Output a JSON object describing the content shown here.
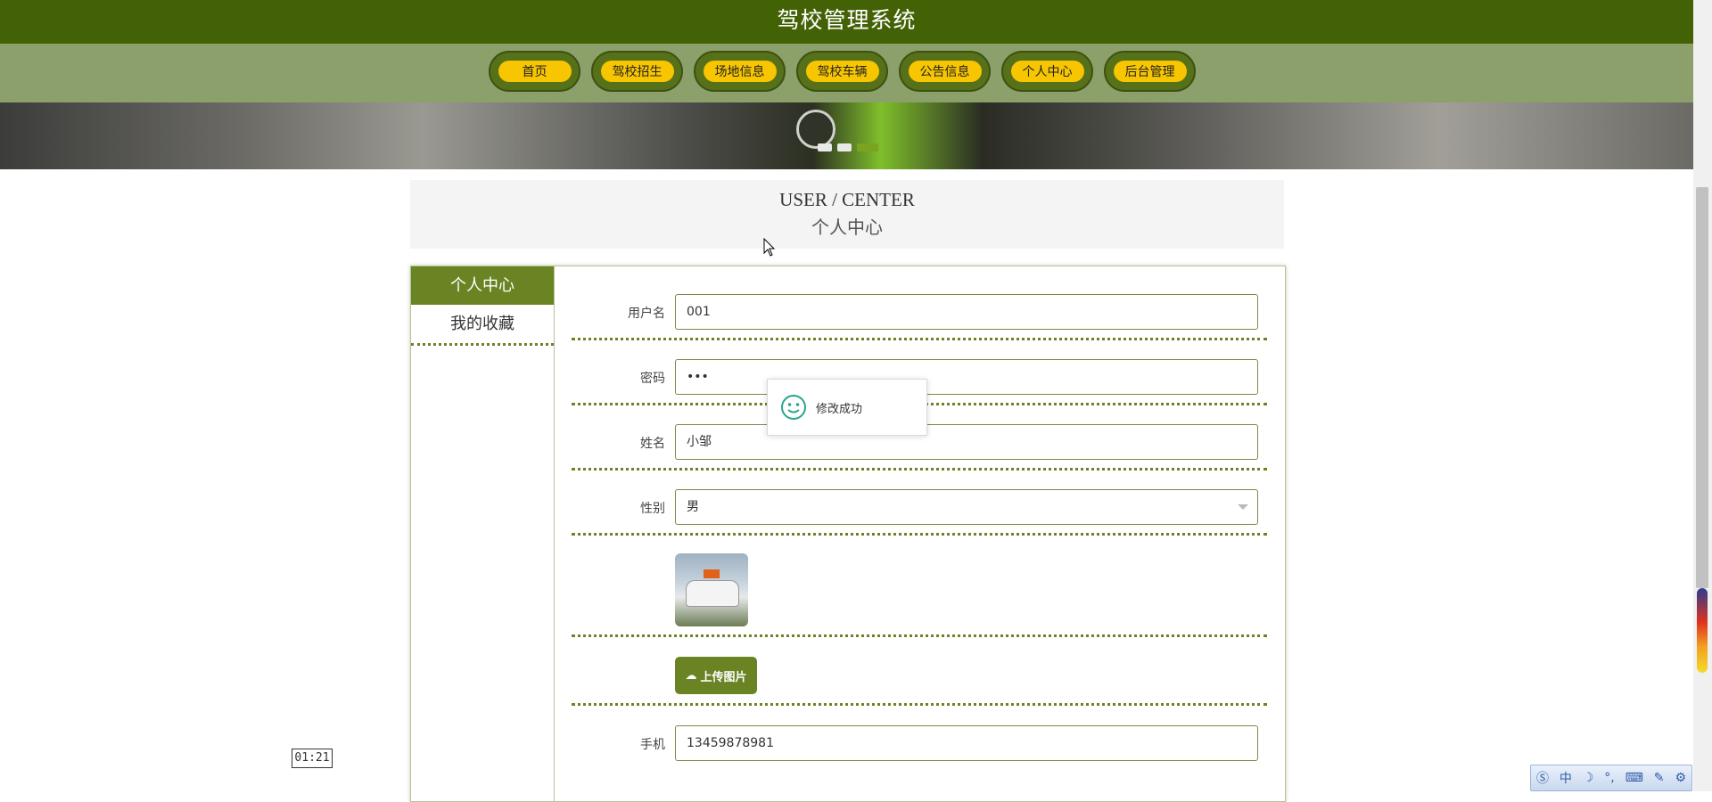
{
  "header": {
    "title": "驾校管理系统"
  },
  "nav": {
    "items": [
      {
        "label": "首页"
      },
      {
        "label": "驾校招生"
      },
      {
        "label": "场地信息"
      },
      {
        "label": "驾校车辆"
      },
      {
        "label": "公告信息"
      },
      {
        "label": "个人中心"
      },
      {
        "label": "后台管理"
      }
    ]
  },
  "section": {
    "title_en": "USER / CENTER",
    "title_cn": "个人中心"
  },
  "sidebar": {
    "items": [
      {
        "label": "个人中心",
        "active": true
      },
      {
        "label": "我的收藏",
        "active": false
      }
    ]
  },
  "form": {
    "username": {
      "label": "用户名",
      "value": "001"
    },
    "password": {
      "label": "密码",
      "value": "•••"
    },
    "name": {
      "label": "姓名",
      "value": "小邹"
    },
    "gender": {
      "label": "性别",
      "value": "男"
    },
    "upload_label": "上传图片",
    "phone": {
      "label": "手机",
      "value": "13459878981"
    }
  },
  "toast": {
    "message": "修改成功"
  },
  "video_time": "01:21",
  "colors": {
    "header": "#436206",
    "nav_bar": "#8ba06a",
    "accent": "#6a8424",
    "nav_pill": "#f7c600"
  }
}
